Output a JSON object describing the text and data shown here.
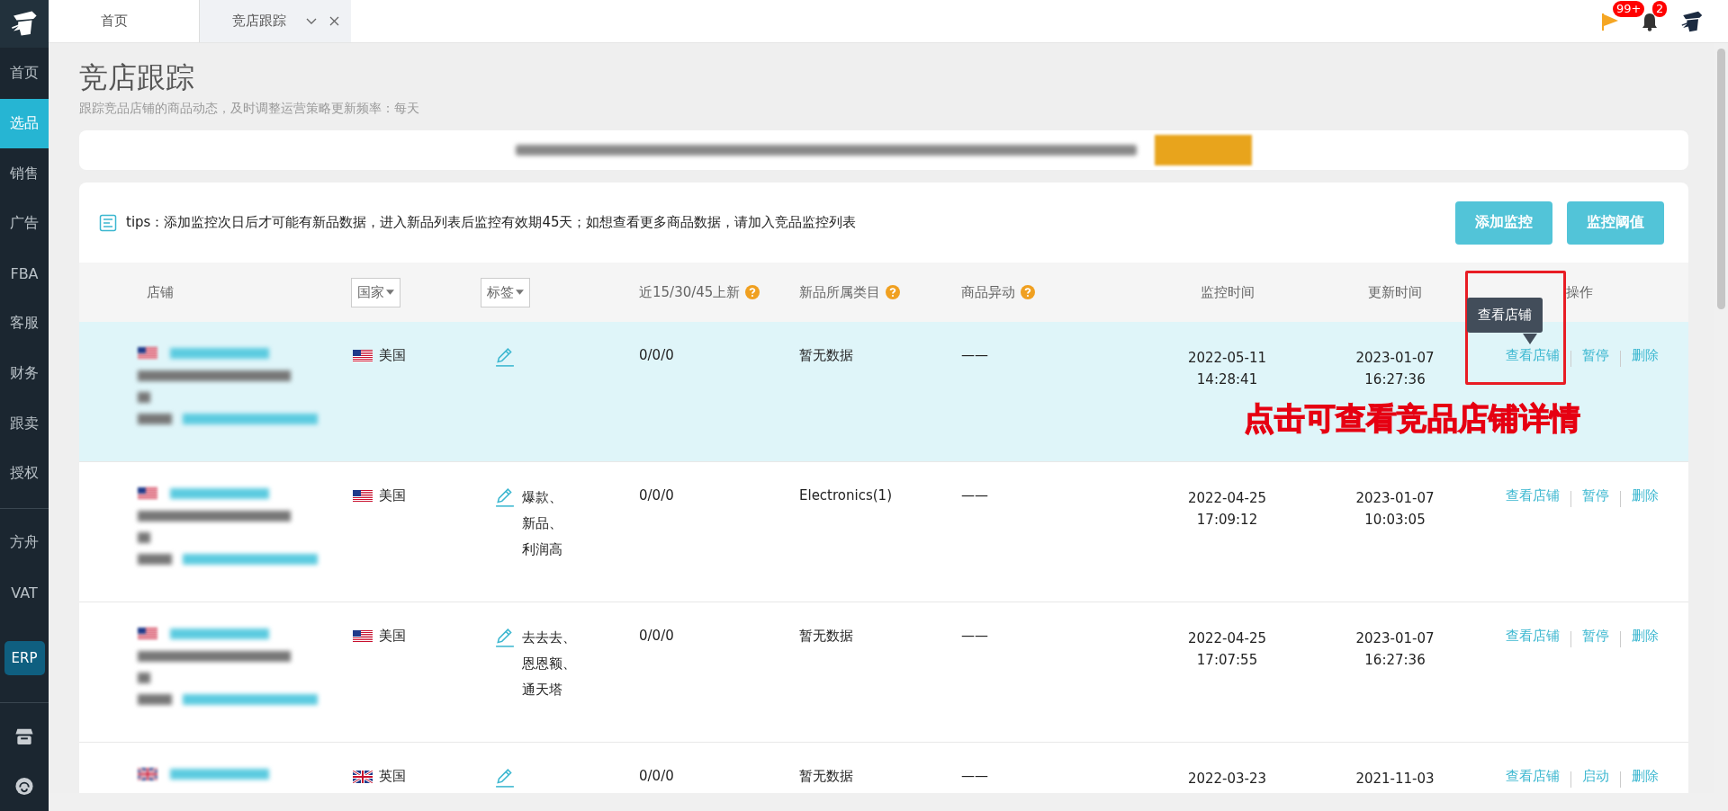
{
  "sidebar": {
    "items": [
      {
        "label": "首页",
        "selected": false
      },
      {
        "label": "选品",
        "selected": true
      },
      {
        "label": "销售",
        "selected": false
      },
      {
        "label": "广告",
        "selected": false
      },
      {
        "label": "FBA",
        "selected": false
      },
      {
        "label": "客服",
        "selected": false
      },
      {
        "label": "财务",
        "selected": false
      },
      {
        "label": "跟卖",
        "selected": false
      },
      {
        "label": "授权",
        "selected": false
      }
    ],
    "lower_items": [
      "方舟",
      "VAT"
    ],
    "erp_button": "ERP"
  },
  "tabs": [
    {
      "label": "首页",
      "selected": false,
      "closable": false
    },
    {
      "label": "竞店跟踪",
      "selected": true,
      "closable": true
    }
  ],
  "header": {
    "flag_badge": "99+",
    "bell_badge": "2"
  },
  "page": {
    "title": "竞店跟踪",
    "subtitle": "跟踪竞品店铺的商品动态，及时调整运营策略更新频率：每天"
  },
  "tips": "tips：添加监控次日后才可能有新品数据，进入新品列表后监控有效期45天；如想查看更多商品数据，请加入竞品监控列表",
  "toolbar_buttons": [
    "添加监控",
    "监控阈值"
  ],
  "table": {
    "columns": [
      {
        "label": "店铺",
        "kind": "plain"
      },
      {
        "label": "国家",
        "kind": "select"
      },
      {
        "label": "标签",
        "kind": "select"
      },
      {
        "label": "近15/30/45上新",
        "kind": "help"
      },
      {
        "label": "新品所属类目",
        "kind": "help"
      },
      {
        "label": "商品异动",
        "kind": "help"
      },
      {
        "label": "监控时间",
        "kind": "center"
      },
      {
        "label": "更新时间",
        "kind": "center"
      },
      {
        "label": "操作",
        "kind": "center"
      }
    ],
    "rows": [
      {
        "highlighted": true,
        "kind": "us",
        "country": "美国",
        "tags": [],
        "new_counts": "0/0/0",
        "category": "暂无数据",
        "change": "——",
        "monitor_time": [
          "2022-05-11",
          "14:28:41"
        ],
        "update_time": [
          "2023-01-07",
          "16:27:36"
        ],
        "actions": [
          "查看店铺",
          "暂停",
          "删除"
        ]
      },
      {
        "highlighted": false,
        "kind": "us",
        "country": "美国",
        "tags": [
          "爆款、",
          "新品、",
          "利润高"
        ],
        "new_counts": "0/0/0",
        "category": "Electronics(1)",
        "change": "——",
        "monitor_time": [
          "2022-04-25",
          "17:09:12"
        ],
        "update_time": [
          "2023-01-07",
          "10:03:05"
        ],
        "actions": [
          "查看店铺",
          "暂停",
          "删除"
        ]
      },
      {
        "highlighted": false,
        "kind": "us",
        "country": "美国",
        "tags": [
          "去去去、",
          "恩恩额、",
          "通天塔"
        ],
        "new_counts": "0/0/0",
        "category": "暂无数据",
        "change": "——",
        "monitor_time": [
          "2022-04-25",
          "17:07:55"
        ],
        "update_time": [
          "2023-01-07",
          "16:27:36"
        ],
        "actions": [
          "查看店铺",
          "暂停",
          "删除"
        ]
      },
      {
        "highlighted": false,
        "kind": "gb",
        "country": "英国",
        "tags": [],
        "new_counts": "0/0/0",
        "category": "暂无数据",
        "change": "——",
        "monitor_time": [
          "2022-03-23"
        ],
        "update_time": [
          "2021-11-03"
        ],
        "actions": [
          "查看店铺",
          "启动",
          "删除"
        ]
      }
    ]
  },
  "tooltip": "查看店铺",
  "callout": "点击可查看竞品店铺详情"
}
